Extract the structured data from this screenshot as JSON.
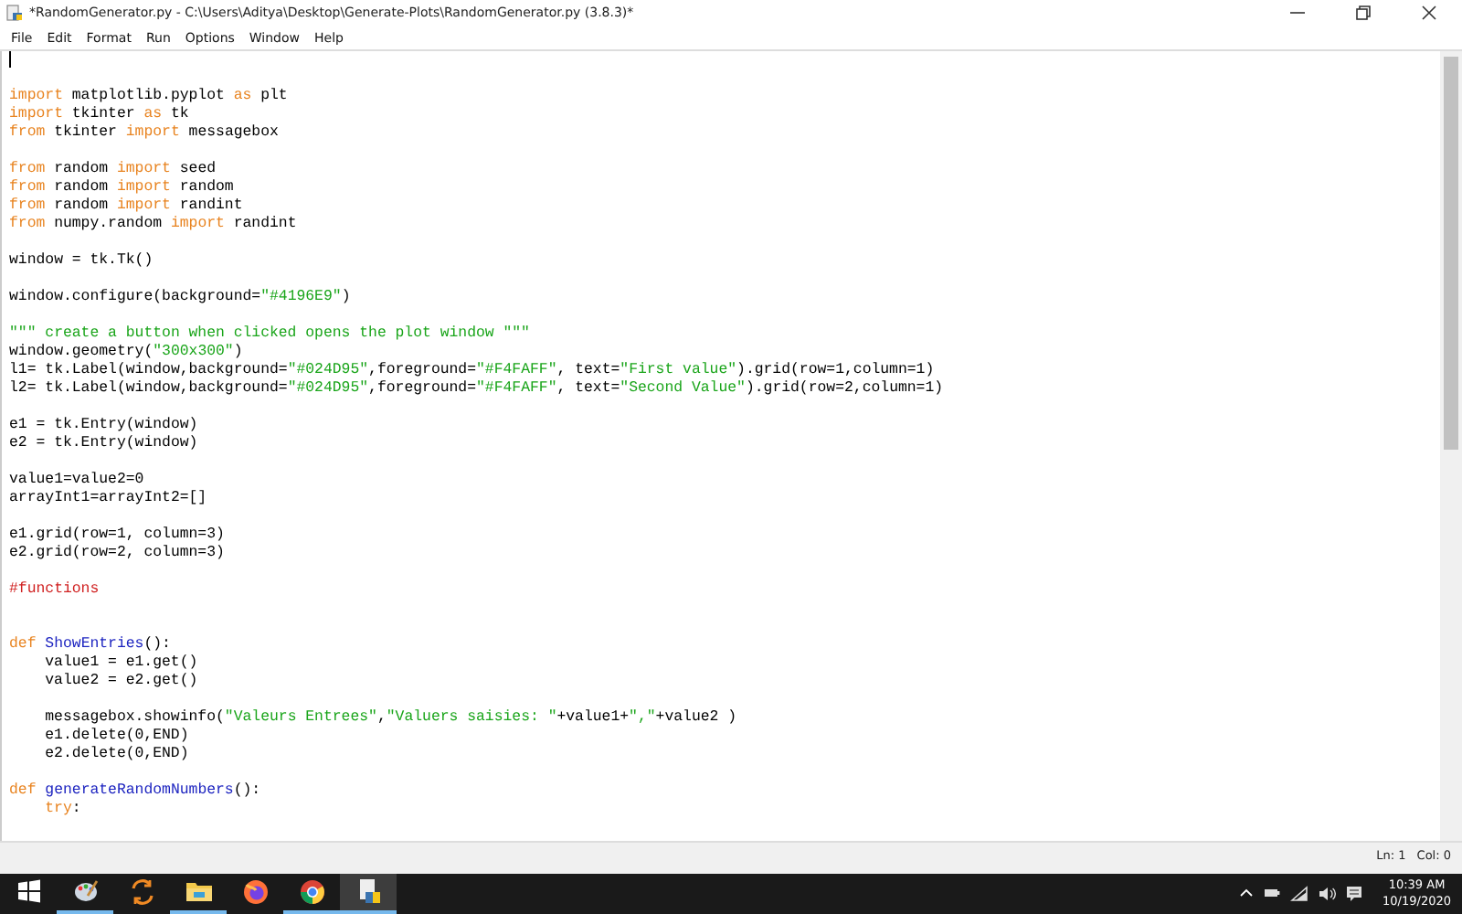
{
  "window": {
    "title": "*RandomGenerator.py - C:\\Users\\Aditya\\Desktop\\Generate-Plots\\RandomGenerator.py (3.8.3)*"
  },
  "menu": [
    "File",
    "Edit",
    "Format",
    "Run",
    "Options",
    "Window",
    "Help"
  ],
  "editor": {
    "blocks": [
      {
        "lines": [
          {
            "cursor": true
          }
        ]
      },
      {
        "lines": [
          {
            "segments": [
              {
                "kind": "keyword",
                "text": "import"
              },
              {
                "kind": "plain",
                "text": " matplotlib.pyplot "
              },
              {
                "kind": "keyword",
                "text": "as"
              },
              {
                "kind": "plain",
                "text": " plt"
              }
            ]
          },
          {
            "segments": [
              {
                "kind": "keyword",
                "text": "import"
              },
              {
                "kind": "plain",
                "text": " tkinter "
              },
              {
                "kind": "keyword",
                "text": "as"
              },
              {
                "kind": "plain",
                "text": " tk"
              }
            ]
          },
          {
            "segments": [
              {
                "kind": "keyword",
                "text": "from"
              },
              {
                "kind": "plain",
                "text": " tkinter "
              },
              {
                "kind": "keyword",
                "text": "import"
              },
              {
                "kind": "plain",
                "text": " messagebox"
              }
            ]
          }
        ]
      },
      {
        "lines": [
          {
            "segments": [
              {
                "kind": "keyword",
                "text": "from"
              },
              {
                "kind": "plain",
                "text": " random "
              },
              {
                "kind": "keyword",
                "text": "import"
              },
              {
                "kind": "plain",
                "text": " seed"
              }
            ]
          },
          {
            "segments": [
              {
                "kind": "keyword",
                "text": "from"
              },
              {
                "kind": "plain",
                "text": " random "
              },
              {
                "kind": "keyword",
                "text": "import"
              },
              {
                "kind": "plain",
                "text": " random"
              }
            ]
          },
          {
            "segments": [
              {
                "kind": "keyword",
                "text": "from"
              },
              {
                "kind": "plain",
                "text": " random "
              },
              {
                "kind": "keyword",
                "text": "import"
              },
              {
                "kind": "plain",
                "text": " randint"
              }
            ]
          },
          {
            "segments": [
              {
                "kind": "keyword",
                "text": "from"
              },
              {
                "kind": "plain",
                "text": " numpy.random "
              },
              {
                "kind": "keyword",
                "text": "import"
              },
              {
                "kind": "plain",
                "text": " randint"
              }
            ]
          }
        ]
      },
      {
        "lines": [
          {
            "segments": [
              {
                "kind": "plain",
                "text": "window = tk.Tk()"
              }
            ]
          }
        ]
      },
      {
        "lines": [
          {
            "segments": [
              {
                "kind": "plain",
                "text": "window.configure(background="
              },
              {
                "kind": "string",
                "text": "\"#4196E9\""
              },
              {
                "kind": "plain",
                "text": ")"
              }
            ]
          }
        ]
      },
      {
        "lines": [
          {
            "segments": [
              {
                "kind": "string",
                "text": "\"\"\" create a button when clicked opens the plot window \"\"\""
              }
            ]
          },
          {
            "segments": [
              {
                "kind": "plain",
                "text": "window.geometry("
              },
              {
                "kind": "string",
                "text": "\"300x300\""
              },
              {
                "kind": "plain",
                "text": ")"
              }
            ]
          },
          {
            "segments": [
              {
                "kind": "plain",
                "text": "l1= tk.Label(window,background="
              },
              {
                "kind": "string",
                "text": "\"#024D95\""
              },
              {
                "kind": "plain",
                "text": ",foreground="
              },
              {
                "kind": "string",
                "text": "\"#F4FAFF\""
              },
              {
                "kind": "plain",
                "text": ", text="
              },
              {
                "kind": "string",
                "text": "\"First value\""
              },
              {
                "kind": "plain",
                "text": ").grid(row=1,column=1)"
              }
            ]
          },
          {
            "segments": [
              {
                "kind": "plain",
                "text": "l2= tk.Label(window,background="
              },
              {
                "kind": "string",
                "text": "\"#024D95\""
              },
              {
                "kind": "plain",
                "text": ",foreground="
              },
              {
                "kind": "string",
                "text": "\"#F4FAFF\""
              },
              {
                "kind": "plain",
                "text": ", text="
              },
              {
                "kind": "string",
                "text": "\"Second Value\""
              },
              {
                "kind": "plain",
                "text": ").grid(row=2,column=1)"
              }
            ]
          }
        ]
      },
      {
        "lines": [
          {
            "segments": [
              {
                "kind": "plain",
                "text": "e1 = tk.Entry(window)"
              }
            ]
          },
          {
            "segments": [
              {
                "kind": "plain",
                "text": "e2 = tk.Entry(window)"
              }
            ]
          }
        ]
      },
      {
        "lines": [
          {
            "segments": [
              {
                "kind": "plain",
                "text": "value1=value2=0"
              }
            ]
          },
          {
            "segments": [
              {
                "kind": "plain",
                "text": "arrayInt1=arrayInt2=[]"
              }
            ]
          }
        ]
      },
      {
        "lines": [
          {
            "segments": [
              {
                "kind": "plain",
                "text": "e1.grid(row=1, column=3)"
              }
            ]
          },
          {
            "segments": [
              {
                "kind": "plain",
                "text": "e2.grid(row=2, column=3)"
              }
            ]
          }
        ]
      },
      {
        "lines": [
          {
            "segments": [
              {
                "kind": "comment",
                "text": "#functions"
              }
            ]
          }
        ]
      },
      {
        "extra_blank_line": true,
        "lines": [
          {
            "segments": [
              {
                "kind": "keyword",
                "text": "def"
              },
              {
                "kind": "definition",
                "text": " ShowEntries"
              },
              {
                "kind": "plain",
                "text": "():"
              }
            ]
          },
          {
            "indented": true,
            "segments": [
              {
                "kind": "plain",
                "text": "value1 = e1.get()"
              }
            ]
          },
          {
            "indented": true,
            "segments": [
              {
                "kind": "plain",
                "text": "value2 = e2.get()"
              }
            ]
          }
        ]
      },
      {
        "lines": [
          {
            "indented": true,
            "segments": [
              {
                "kind": "plain",
                "text": "messagebox.showinfo("
              },
              {
                "kind": "string",
                "text": "\"Valeurs Entrees\""
              },
              {
                "kind": "plain",
                "text": ","
              },
              {
                "kind": "string",
                "text": "\"Valuers saisies: \""
              },
              {
                "kind": "plain",
                "text": "+value1+"
              },
              {
                "kind": "string",
                "text": "\",\""
              },
              {
                "kind": "plain",
                "text": "+value2 )"
              }
            ]
          },
          {
            "indented": true,
            "segments": [
              {
                "kind": "plain",
                "text": "e1.delete(0,END)"
              }
            ]
          },
          {
            "indented": true,
            "segments": [
              {
                "kind": "plain",
                "text": "e2.delete(0,END)"
              }
            ]
          }
        ]
      },
      {
        "lines": [
          {
            "segments": [
              {
                "kind": "keyword",
                "text": "def"
              },
              {
                "kind": "definition",
                "text": " generateRandomNumbers"
              },
              {
                "kind": "plain",
                "text": "():"
              }
            ]
          },
          {
            "indented": true,
            "segments": [
              {
                "kind": "keyword",
                "text": "try"
              },
              {
                "kind": "plain",
                "text": ":"
              }
            ]
          }
        ]
      }
    ]
  },
  "status_bar": {
    "line": "Ln: 1",
    "column": "Col: 0"
  },
  "taskbar": {
    "apps": [
      {
        "kind": "start",
        "running": false,
        "selected": false
      },
      {
        "kind": "palette",
        "running": true,
        "selected": false
      },
      {
        "kind": "arrows",
        "running": false,
        "selected": false
      },
      {
        "kind": "folder",
        "running": true,
        "selected": false
      },
      {
        "kind": "firefox",
        "running": false,
        "selected": false
      },
      {
        "kind": "chrome",
        "running": true,
        "selected": false
      },
      {
        "kind": "python",
        "running": true,
        "selected": true
      }
    ],
    "time": "10:39 AM",
    "date": "10/19/2020"
  }
}
